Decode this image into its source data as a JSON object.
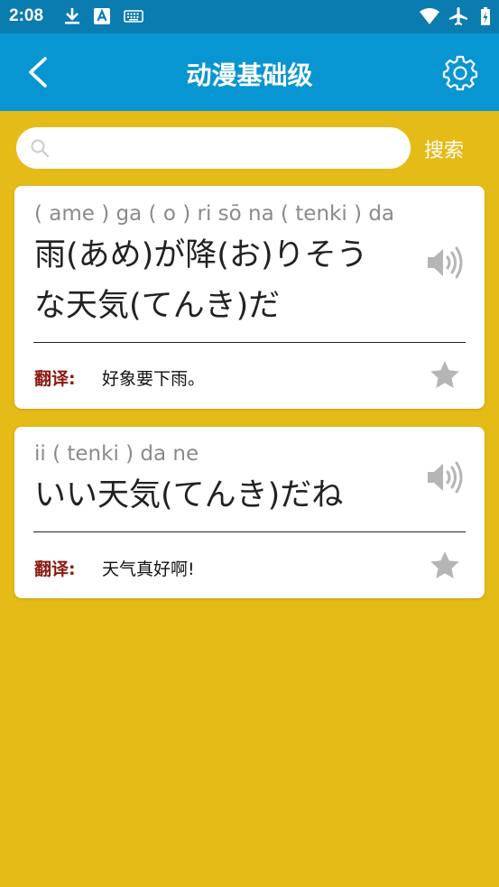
{
  "status_bar": {
    "time": "2:08",
    "icons": [
      "download-icon",
      "text-a-icon",
      "keyboard-icon",
      "wifi-icon",
      "airplane-mode-icon",
      "battery-charging-icon"
    ]
  },
  "app_bar": {
    "title": "动漫基础级",
    "back_icon": "chevron-left-icon",
    "settings_icon": "gear-icon"
  },
  "search": {
    "value": "",
    "placeholder": "",
    "button_label": "搜索"
  },
  "cards": [
    {
      "romaji": "( ame ) ga ( o ) ri sō na ( tenki ) da",
      "japanese_line1": "雨(あめ)が降(お)りそう",
      "japanese_line2": "な天気(てんき)だ",
      "translation_label": "翻译:",
      "translation": "好象要下雨。"
    },
    {
      "romaji": "ii ( tenki ) da ne",
      "japanese_line1": "いい天気(てんき)だね",
      "translation_label": "翻译:",
      "translation": "天气真好啊!"
    }
  ],
  "colors": {
    "status_bar": "#0A7CB0",
    "app_bar": "#0896D2",
    "background": "#E5BB17",
    "translation_label": "#8B1A10",
    "icon_gray": "#B5B5B5"
  }
}
